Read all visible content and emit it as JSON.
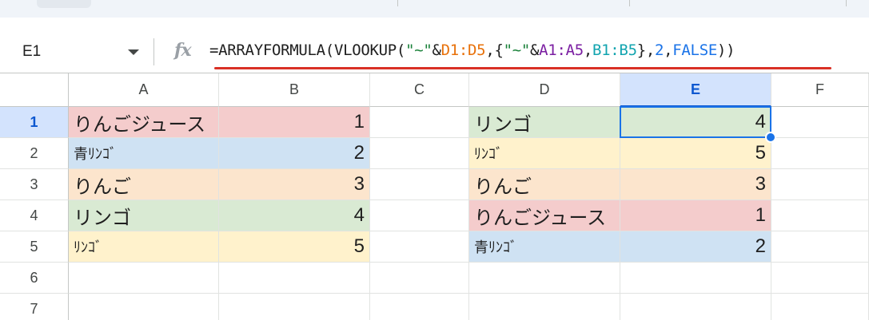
{
  "formula_bar": {
    "name_box": "E1",
    "fx_label": "fx",
    "formula_tokens": [
      {
        "text": "=ARRAYFORMULA(VLOOKUP(",
        "kind": "plain"
      },
      {
        "text": "\"~\"",
        "kind": "str"
      },
      {
        "text": "&",
        "kind": "plain"
      },
      {
        "text": "D1:D5",
        "kind": "d"
      },
      {
        "text": ",{",
        "kind": "plain"
      },
      {
        "text": "\"~\"",
        "kind": "str"
      },
      {
        "text": "&",
        "kind": "plain"
      },
      {
        "text": "A1:A5",
        "kind": "a"
      },
      {
        "text": ",",
        "kind": "plain"
      },
      {
        "text": "B1:B5",
        "kind": "b"
      },
      {
        "text": "},",
        "kind": "plain"
      },
      {
        "text": "2",
        "kind": "num"
      },
      {
        "text": ",",
        "kind": "plain"
      },
      {
        "text": "FALSE",
        "kind": "bool"
      },
      {
        "text": "))",
        "kind": "plain"
      }
    ]
  },
  "columns": [
    "A",
    "B",
    "C",
    "D",
    "E",
    "F"
  ],
  "selected_column": "E",
  "rows": [
    "1",
    "2",
    "3",
    "4",
    "5",
    "6",
    "7"
  ],
  "selected_row": "1",
  "cells": {
    "A": [
      "りんごジュース",
      "青ﾘﾝｺﾞ",
      "りんご",
      "リンゴ",
      "ﾘﾝｺﾞ"
    ],
    "B": [
      "1",
      "2",
      "3",
      "4",
      "5"
    ],
    "D": [
      "リンゴ",
      "ﾘﾝｺﾞ",
      "りんご",
      "りんごジュース",
      "青ﾘﾝｺﾞ"
    ],
    "E": [
      "4",
      "5",
      "3",
      "1",
      "2"
    ]
  },
  "colors": {
    "red": "#f4cccc",
    "blue": "#cfe2f3",
    "orange": "#fce5cd",
    "green": "#d9ead3",
    "yellow": "#fff2cc",
    "selection": "#1a73e8",
    "formula_error_underline": "#d93025"
  }
}
